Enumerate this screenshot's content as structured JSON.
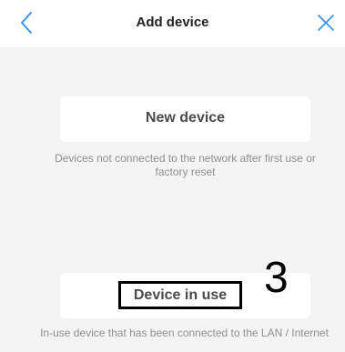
{
  "header": {
    "title": "Add device",
    "back_icon": "chevron-left-icon",
    "close_icon": "close-icon",
    "accent_color": "#2f8ff0"
  },
  "options": [
    {
      "label": "New device",
      "description": "Devices not connected to the network after first use or factory reset"
    },
    {
      "label": "Device in use",
      "description": "In-use device that has been connected to the LAN / Internet"
    }
  ],
  "annotation": {
    "step": "3"
  }
}
